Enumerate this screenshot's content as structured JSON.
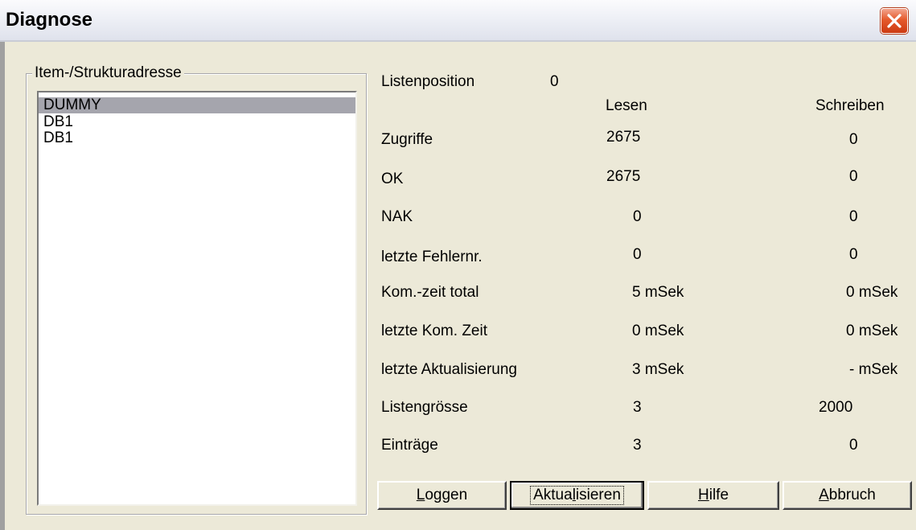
{
  "window": {
    "title": "Diagnose"
  },
  "group": {
    "label": "Item-/Strukturadresse"
  },
  "list": {
    "items": [
      "DUMMY",
      "DB1",
      "DB1"
    ],
    "selected_index": 0
  },
  "stats": {
    "list_position_label": "Listenposition",
    "list_position_value": "0",
    "col_read": "Lesen",
    "col_write": "Schreiben",
    "rows": [
      {
        "label": "Zugriffe",
        "read": "2675",
        "write": "0"
      },
      {
        "label": "OK",
        "read": "2675",
        "write": "0"
      },
      {
        "label": "NAK",
        "read": "0",
        "write": "0"
      },
      {
        "label": "letzte Fehlernr.",
        "read": "0",
        "write": "0"
      },
      {
        "label": "Kom.-zeit total",
        "read": "5 mSek",
        "write": "0  mSek"
      },
      {
        "label": "letzte Kom. Zeit",
        "read": "0 mSek",
        "write": "0  mSek"
      },
      {
        "label": "letzte Aktualisierung",
        "read": "3 mSek",
        "write": "-  mSek"
      },
      {
        "label": "Listengrösse",
        "read": "3",
        "write": "2000"
      },
      {
        "label": "Einträge",
        "read": "3",
        "write": "0"
      }
    ]
  },
  "buttons": {
    "log": {
      "pre": "",
      "accel": "L",
      "post": "oggen"
    },
    "refresh": {
      "pre": "Aktua",
      "accel": "l",
      "post": "isieren"
    },
    "help": {
      "pre": "",
      "accel": "H",
      "post": "ilfe"
    },
    "cancel": {
      "pre": "",
      "accel": "A",
      "post": "bbruch"
    }
  },
  "colors": {
    "selection": "#a5a5ad",
    "dialog_bg": "#ece9d8",
    "close_button": "#e55a2c"
  },
  "icons": {
    "close": "close-icon"
  }
}
